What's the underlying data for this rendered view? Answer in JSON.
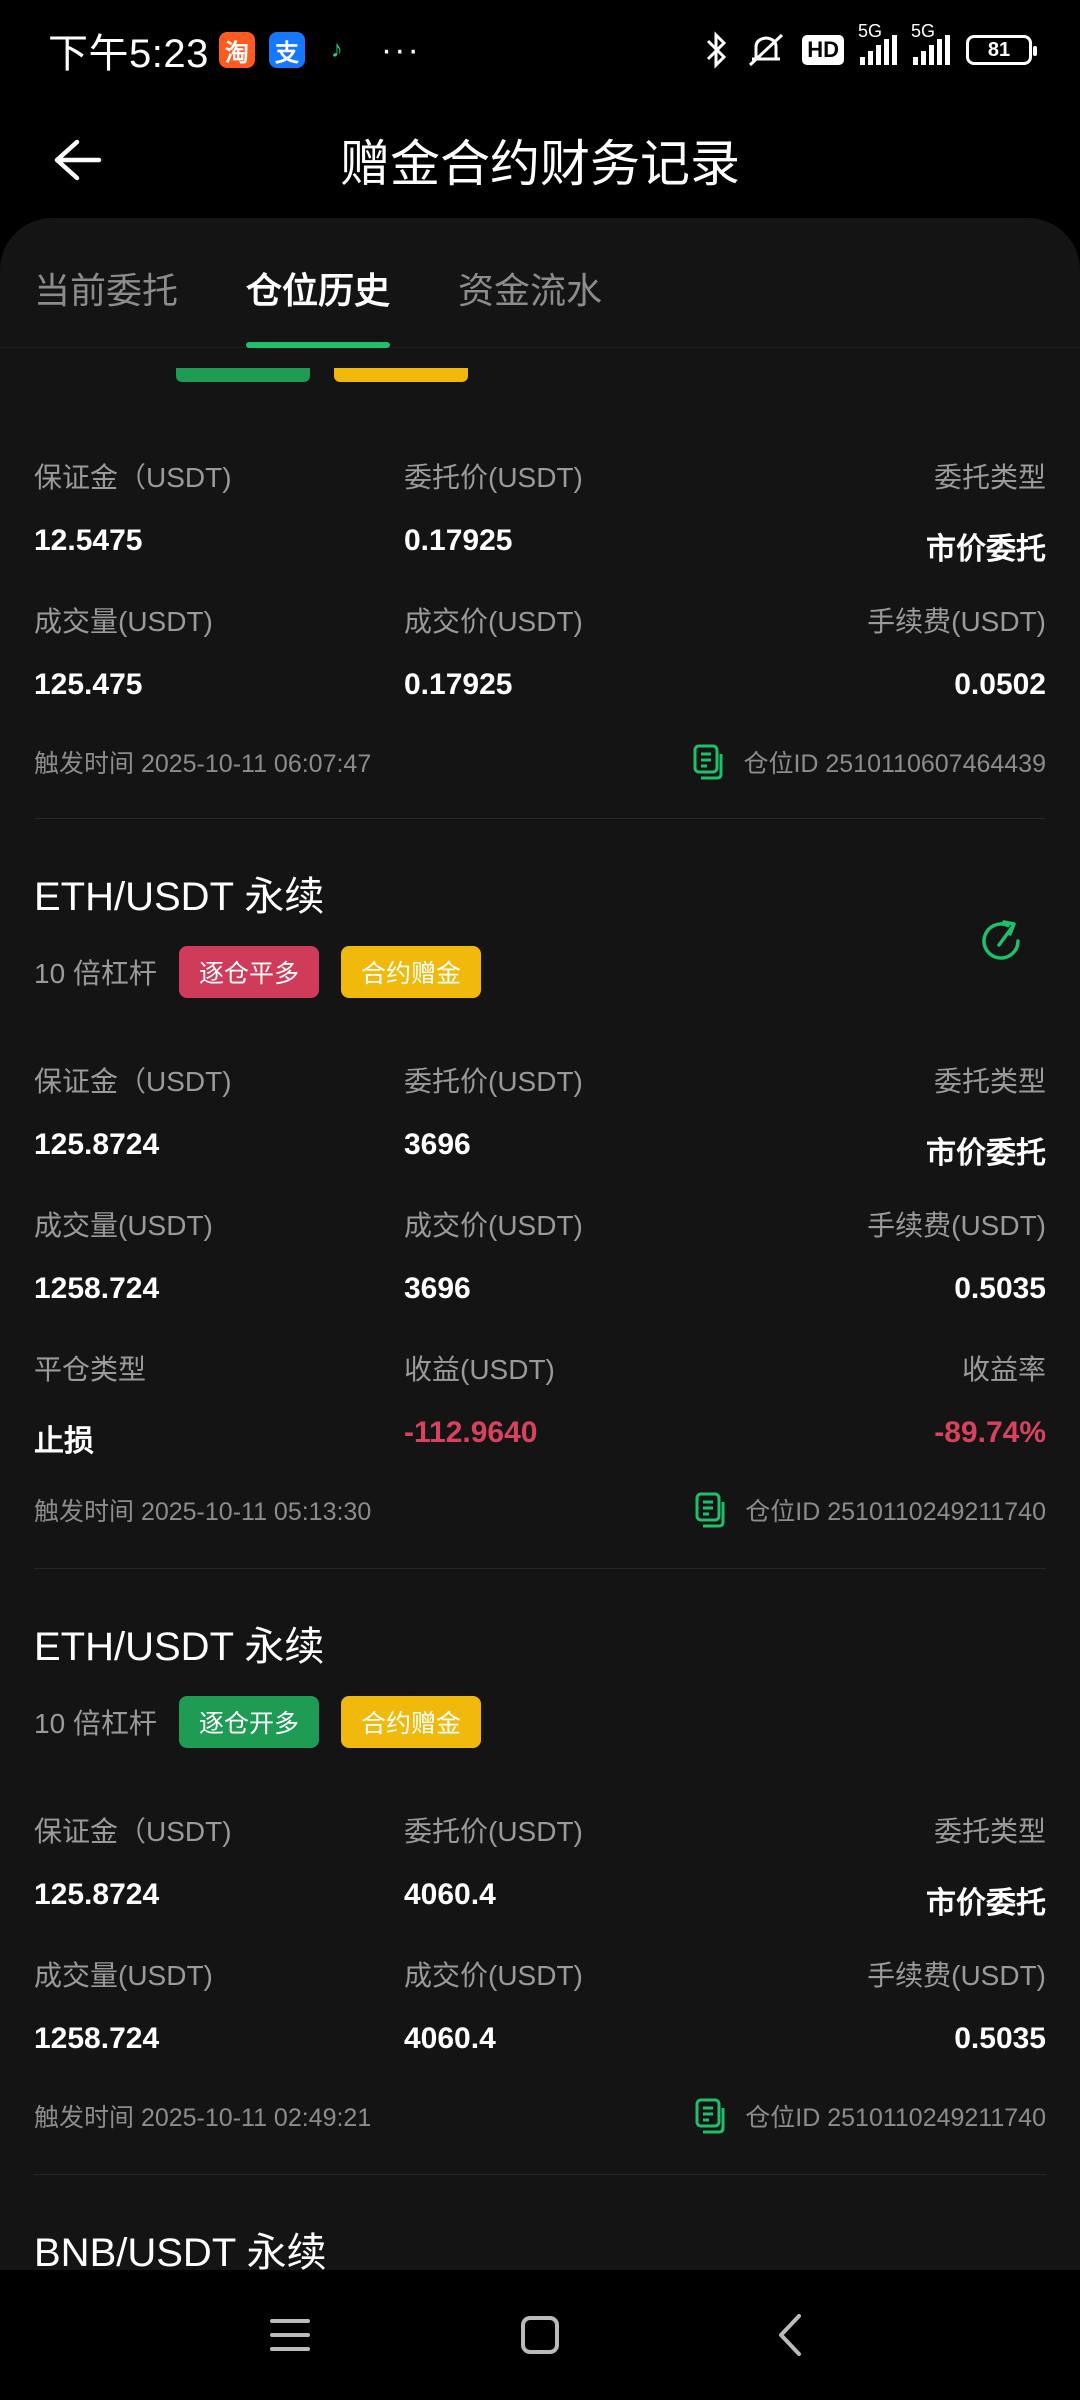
{
  "status": {
    "time": "下午5:23",
    "more": "···",
    "net_label_1": "5G",
    "net_label_2": "5G",
    "hd": "HD",
    "battery": "81"
  },
  "header": {
    "title": "赠金合约财务记录"
  },
  "tabs": [
    {
      "label": "当前委托"
    },
    {
      "label": "仓位历史"
    },
    {
      "label": "资金流水"
    }
  ],
  "colors": {
    "accent": "#1fbf6b",
    "negative": "#d9425f",
    "gold": "#f0b90b",
    "tag_red": "#cf3b58",
    "tag_green": "#1f9c53"
  },
  "record1": {
    "fields": [
      {
        "label": "保证金（USDT)",
        "value": "12.5475"
      },
      {
        "label": "委托价(USDT)",
        "value": "0.17925"
      },
      {
        "label": "委托类型",
        "value": "市价委托"
      },
      {
        "label": "成交量(USDT)",
        "value": "125.475"
      },
      {
        "label": "成交价(USDT)",
        "value": "0.17925"
      },
      {
        "label": "手续费(USDT)",
        "value": "0.0502"
      }
    ],
    "time": "触发时间 2025-10-11 06:07:47",
    "position_id": "仓位ID 2510110607464439"
  },
  "record2": {
    "title": "ETH/USDT 永续",
    "leverage": "10 倍杠杆",
    "tag1": "逐仓平多",
    "tag2": "合约赠金",
    "fields": [
      {
        "label": "保证金（USDT)",
        "value": "125.8724"
      },
      {
        "label": "委托价(USDT)",
        "value": "3696"
      },
      {
        "label": "委托类型",
        "value": "市价委托"
      },
      {
        "label": "成交量(USDT)",
        "value": "1258.724"
      },
      {
        "label": "成交价(USDT)",
        "value": "3696"
      },
      {
        "label": "手续费(USDT)",
        "value": "0.5035"
      },
      {
        "label": "平仓类型",
        "value": "止损"
      },
      {
        "label": "收益(USDT)",
        "value": "-112.9640"
      },
      {
        "label": "收益率",
        "value": "-89.74%"
      }
    ],
    "time": "触发时间 2025-10-11 05:13:30",
    "position_id": "仓位ID 2510110249211740"
  },
  "record3": {
    "title": "ETH/USDT 永续",
    "leverage": "10 倍杠杆",
    "tag1": "逐仓开多",
    "tag2": "合约赠金",
    "fields": [
      {
        "label": "保证金（USDT)",
        "value": "125.8724"
      },
      {
        "label": "委托价(USDT)",
        "value": "4060.4"
      },
      {
        "label": "委托类型",
        "value": "市价委托"
      },
      {
        "label": "成交量(USDT)",
        "value": "1258.724"
      },
      {
        "label": "成交价(USDT)",
        "value": "4060.4"
      },
      {
        "label": "手续费(USDT)",
        "value": "0.5035"
      }
    ],
    "time": "触发时间 2025-10-11 02:49:21",
    "position_id": "仓位ID 2510110249211740"
  },
  "record4": {
    "title": "BNB/USDT 永续"
  }
}
